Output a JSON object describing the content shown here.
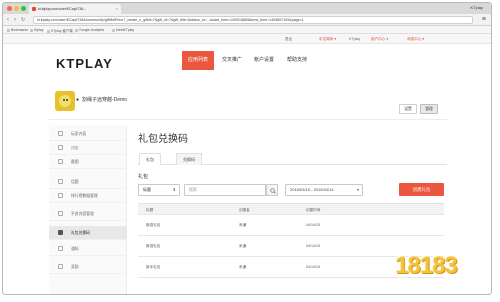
{
  "browser": {
    "tab_title": "kt.ktplay.com/user/ECapi/736...",
    "user": "KTplay",
    "url": "kt.ktplay.com/user/ECapi/7364/community/gift/listPrice?_create_n_giftid=7&gift_id=7&gift_title=&status_id=...&start_time=1409248808&end_time=1409857199&page=1",
    "bookmarks": [
      "Bookmarks",
      "Ktplay",
      "KTplay 客户端",
      "Google Analytics",
      "MeetKTplay"
    ],
    "colors": {
      "tabbar": "#d9d9d9",
      "toolbar": "#f2f2f2"
    }
  },
  "site_top": {
    "items": [
      "退出",
      "中文简体 ▾",
      "KTplay",
      "用户中心 ▾",
      "消息中心 ▾"
    ]
  },
  "header": {
    "logo": "KTPLAY",
    "nav": [
      "应用列表",
      "交叉推广",
      "帐户设置",
      "帮助支持"
    ],
    "active_nav": 0,
    "colors": {
      "accent": "#e9573f"
    }
  },
  "app": {
    "name": "割绳子远穿越-Demo",
    "platform_icon": "apple-icon",
    "settings_label": "设置",
    "manage_label": "管理"
  },
  "sidebar": {
    "items": [
      {
        "label": "玩家内容",
        "icon": "home-icon"
      },
      {
        "label": "讨论",
        "icon": "chat-icon"
      },
      {
        "label": "截图",
        "icon": "image-icon"
      },
      {
        "label": "话题",
        "icon": "topic-icon"
      },
      {
        "label": "排行榜数据管理",
        "icon": "ranking-icon"
      },
      {
        "label": "不良内容管理",
        "icon": "shield-icon"
      },
      {
        "label": "礼包兑换码",
        "icon": "gift-icon",
        "active": true
      },
      {
        "label": "通知",
        "icon": "bell-icon"
      },
      {
        "label": "奖励",
        "icon": "award-icon"
      }
    ]
  },
  "main": {
    "title": "礼包兑换码",
    "tabs": [
      "礼包",
      "兑换码"
    ],
    "section_label": "礼包",
    "filter_select": "标题",
    "search_placeholder": "搜索",
    "date_range": "2015/03/15 - 2015/04/14",
    "create_button": "创建礼包",
    "table": {
      "headers": [
        "标题",
        "创建者",
        "创建时间"
      ],
      "rows": [
        [
          "新游礼包",
          "系通",
          "04/14/15"
        ],
        [
          "新游礼包",
          "系通",
          "04/14/15"
        ],
        [
          "新手礼包",
          "系通",
          "04/14/15"
        ]
      ]
    }
  },
  "watermark": "18183"
}
